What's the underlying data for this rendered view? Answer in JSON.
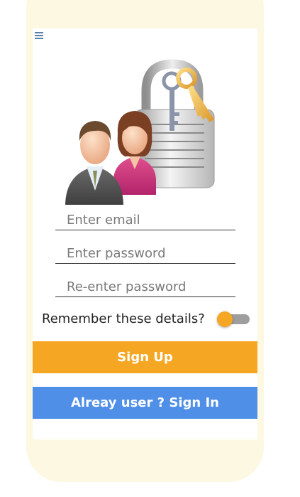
{
  "icons": {
    "menu": "hamburger-menu-icon",
    "hero": "users-padlock-key-illustration"
  },
  "colors": {
    "frame": "#fdf8e1",
    "accent_orange": "#f5a623",
    "accent_blue": "#4f8fe8",
    "menu_icon": "#5b7fa6"
  },
  "form": {
    "email_placeholder": "Enter email",
    "password_placeholder": "Enter password",
    "confirm_password_placeholder": "Re-enter password",
    "remember_label": "Remember these details?",
    "remember_on": false
  },
  "buttons": {
    "signup_label": "Sign Up",
    "signin_label": "Alreay user ? Sign In"
  }
}
